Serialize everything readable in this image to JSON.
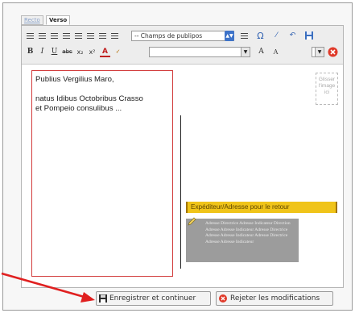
{
  "tabs": [
    {
      "label": "Recto",
      "active": false
    },
    {
      "label": "Verso",
      "active": true
    }
  ],
  "toolbar": {
    "styles_select_value": "-- Champs de publipos",
    "row2_left": [
      "B",
      "I",
      "U",
      "abc",
      "x₂",
      "x²",
      "A"
    ],
    "font_grow": "A",
    "font_shrink": "A"
  },
  "address": {
    "lines": [
      "Publius Vergilius Maro,",
      "",
      "natus Idibus Octobribus Crasso",
      "et Pompeio consulibus ..."
    ]
  },
  "drop_zone": {
    "text": "Glisser l'image ici"
  },
  "sender": {
    "label": "Expéditeur/Adresse pour le retour",
    "placeholder": "Adresse Directrice Adresse Indicateur Direction Adresse Adresse Indicateur Adresse Directrice Adresse Adresse Indicateur Adresse Directrice Adresse Adresse Indicateur"
  },
  "buttons": {
    "save": "Enregistrer et continuer",
    "reject": "Rejeter les modifications"
  },
  "colors": {
    "address_border": "#d23b3b",
    "sender_label_bg": "#f0c419",
    "arrow": "#e02020"
  }
}
